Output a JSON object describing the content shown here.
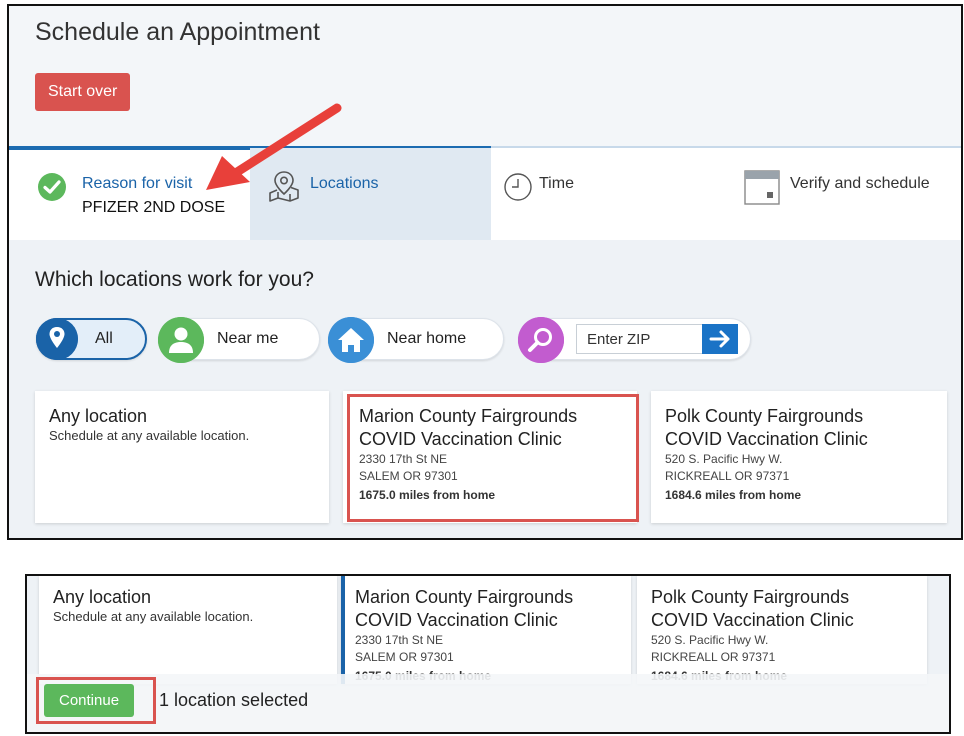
{
  "header": {
    "title": "Schedule an Appointment",
    "start_over_label": "Start over"
  },
  "steps": [
    {
      "label": "Reason for visit",
      "sub": "PFIZER 2ND DOSE",
      "state": "complete"
    },
    {
      "label": "Locations",
      "state": "active"
    },
    {
      "label": "Time",
      "state": "pending"
    },
    {
      "label": "Verify and schedule",
      "state": "pending"
    }
  ],
  "question": "Which locations work for you?",
  "filters": {
    "all_label": "All",
    "near_me_label": "Near me",
    "near_home_label": "Near home",
    "zip_placeholder": "Enter ZIP"
  },
  "locations": [
    {
      "name": "Any location",
      "description": "Schedule at any available location."
    },
    {
      "name_line1": "Marion County Fairgrounds",
      "name_line2": "COVID Vaccination Clinic",
      "address1": "2330 17th St NE",
      "address2": "SALEM OR 97301",
      "distance": "1675.0 miles from home"
    },
    {
      "name_line1": "Polk County Fairgrounds",
      "name_line2": "COVID Vaccination Clinic",
      "address1": "520 S. Pacific Hwy W.",
      "address2": "RICKREALL OR 97371",
      "distance": "1684.6 miles from home"
    }
  ],
  "footer": {
    "continue_label": "Continue",
    "selected_text": "1 location selected"
  },
  "colors": {
    "primary": "#1a63a8",
    "danger": "#d9534f",
    "success": "#5cb85c",
    "annotation": "#e8403a"
  },
  "icons": [
    "check-circle-icon",
    "map-pin-icon",
    "clock-icon",
    "calendar-icon",
    "location-icon",
    "person-icon",
    "home-icon",
    "search-icon",
    "arrow-right-icon"
  ]
}
